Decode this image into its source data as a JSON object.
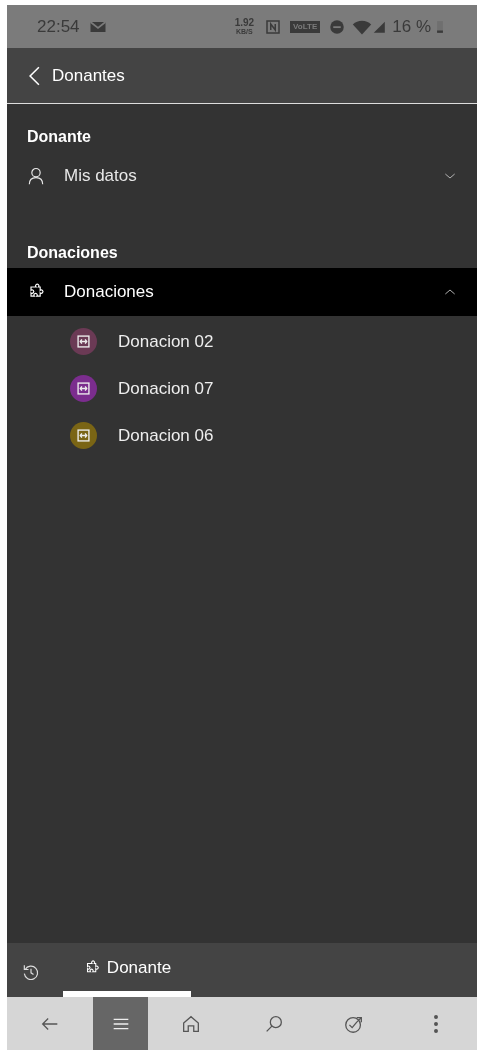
{
  "status_bar": {
    "time": "22:54",
    "net_speed": "1.92",
    "net_unit": "KB/S",
    "volte": "VoLTE",
    "battery": "16 %"
  },
  "header": {
    "title": "Donantes"
  },
  "sections": [
    {
      "heading": "Donante",
      "items": [
        {
          "label": "Mis datos",
          "kind": "person",
          "selected": false,
          "expanded": false
        }
      ]
    },
    {
      "heading": "Donaciones",
      "items": [
        {
          "label": "Donaciones",
          "kind": "puzzle",
          "selected": true,
          "expanded": true,
          "children": [
            {
              "label": "Donacion 02",
              "color": "#6b3a55"
            },
            {
              "label": "Donacion 07",
              "color": "#7b2d8e"
            },
            {
              "label": "Donacion 06",
              "color": "#7a6515"
            }
          ]
        }
      ]
    }
  ],
  "bottom_tabs": [
    {
      "label": "Donante",
      "selected": true
    }
  ],
  "nav_bar": [
    {
      "kind": "back",
      "selected": false
    },
    {
      "kind": "menu",
      "selected": true
    },
    {
      "kind": "home",
      "selected": false
    },
    {
      "kind": "search",
      "selected": false
    },
    {
      "kind": "goal",
      "selected": false
    },
    {
      "kind": "more",
      "selected": false
    }
  ]
}
